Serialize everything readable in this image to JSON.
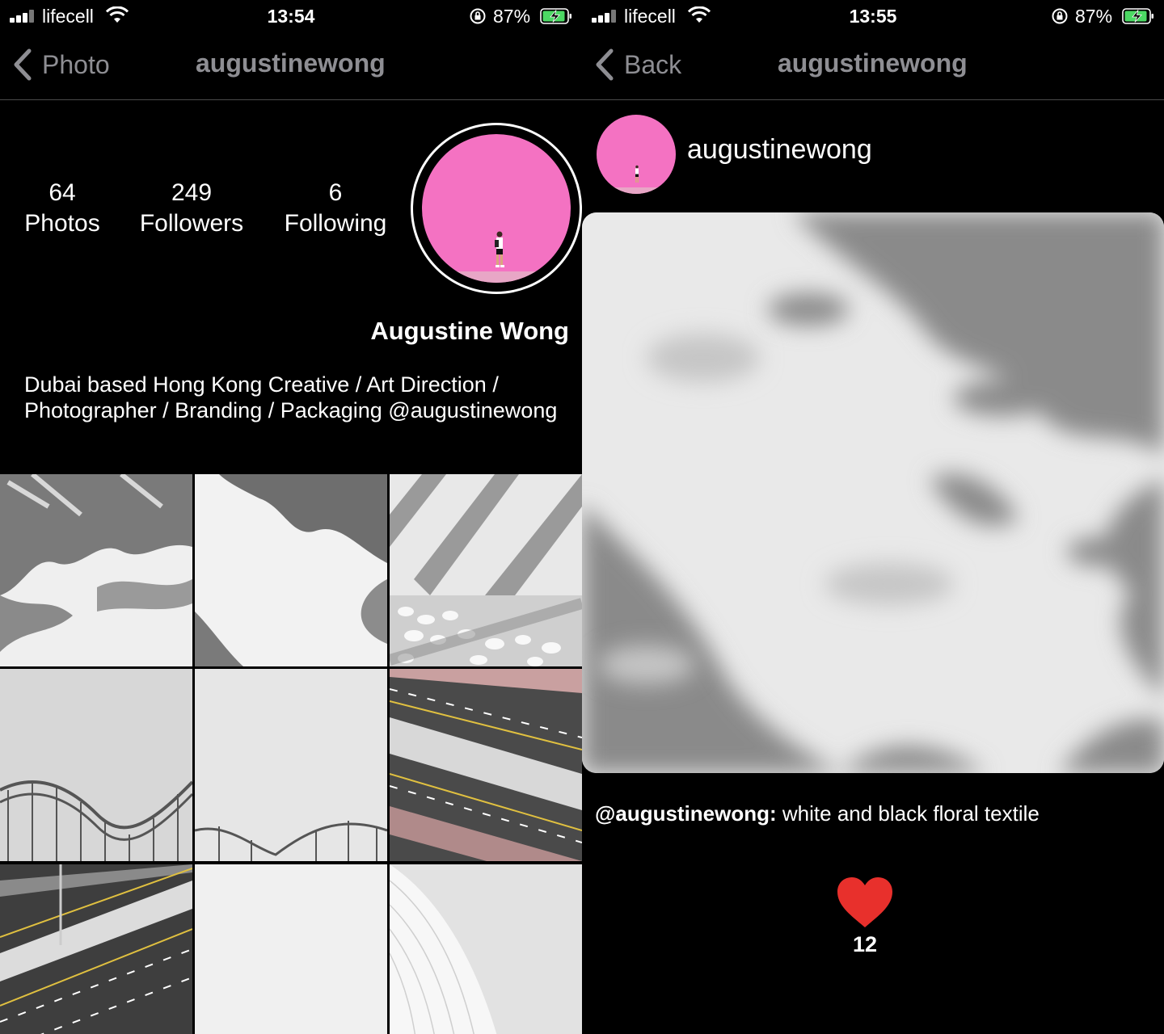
{
  "status_left": {
    "carrier": "lifecell",
    "time": "13:54",
    "battery": "87%"
  },
  "status_right": {
    "carrier": "lifecell",
    "time": "13:55",
    "battery": "87%"
  },
  "profile": {
    "nav": {
      "back_label": "Photo",
      "title": "augustinewong"
    },
    "stats": [
      {
        "value": "64",
        "label": "Photos"
      },
      {
        "value": "249",
        "label": "Followers"
      },
      {
        "value": "6",
        "label": "Following"
      }
    ],
    "full_name": "Augustine Wong",
    "bio": "Dubai based Hong Kong Creative / Art Direction / Photographer / Branding / Packaging @augustinewong",
    "avatar_color": "#f472c2",
    "grid_tiles": [
      "palm-shadow",
      "leaf-shadow",
      "striped-shadow-pebbles",
      "rollercoaster-left",
      "rollercoaster-right",
      "highway-aerial",
      "highway-diagonal",
      "white-sky",
      "white-architecture"
    ]
  },
  "detail": {
    "nav": {
      "back_label": "Back",
      "title": "augustinewong"
    },
    "username": "augustinewong",
    "caption_user": "@augustinewong:",
    "caption_text": " white and black floral textile",
    "likes": "12",
    "heart_color": "#e8302c"
  }
}
